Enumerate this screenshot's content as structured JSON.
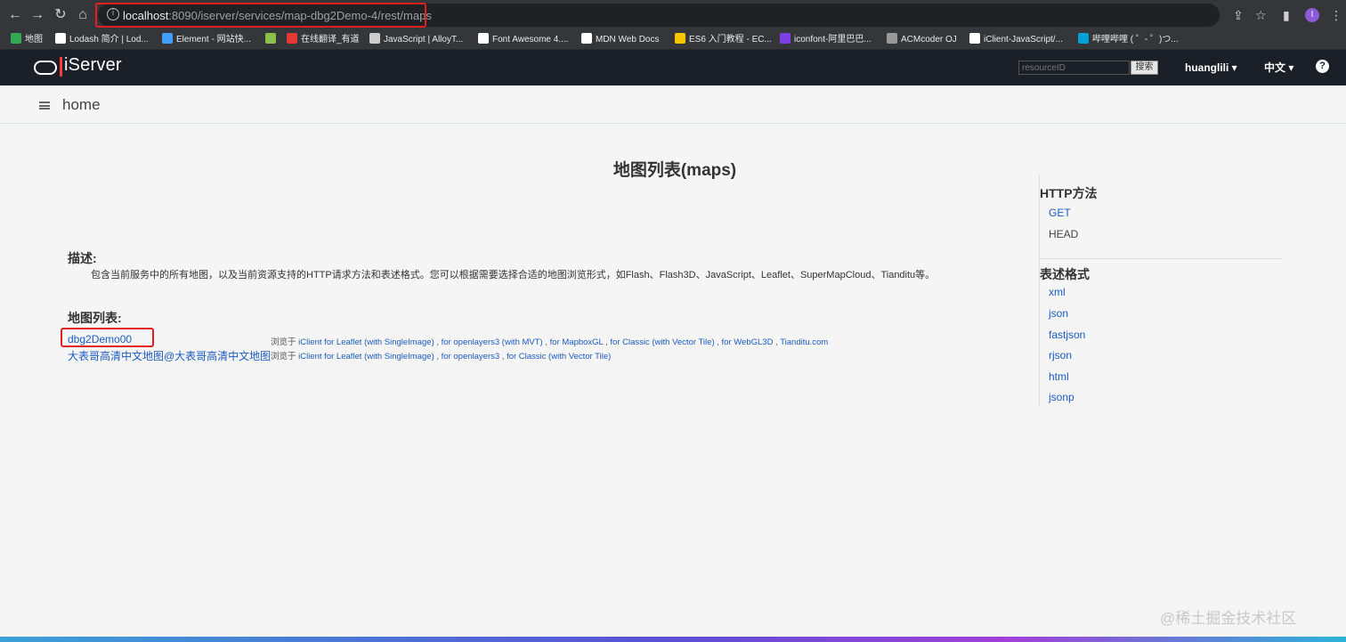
{
  "browser": {
    "url_host": "localhost",
    "url_rest": ":8090/iserver/services/map-dbg2Demo-4/rest/maps",
    "bookmarks": [
      {
        "label": "地图",
        "color": "#34a853"
      },
      {
        "label": "Lodash 简介 | Lod...",
        "color": "#ffffff"
      },
      {
        "label": "Element - 网站快...",
        "color": "#409eff"
      },
      {
        "label": "",
        "color": "#8bc34a"
      },
      {
        "label": "在线翻译_有道",
        "color": "#e53935"
      },
      {
        "label": "JavaScript | AlloyT...",
        "color": "#cccccc"
      },
      {
        "label": "Font Awesome 4....",
        "color": "#ffffff"
      },
      {
        "label": "MDN Web Docs",
        "color": "#ffffff"
      },
      {
        "label": "ES6 入门教程 - EC...",
        "color": "#f7c600"
      },
      {
        "label": "iconfont-阿里巴巴...",
        "color": "#7b3fe4"
      },
      {
        "label": "ACMcoder OJ",
        "color": "#999999"
      },
      {
        "label": "iClient-JavaScript/...",
        "color": "#ffffff"
      },
      {
        "label": "哔哩哔哩 ( ゜- ゜)つ...",
        "color": "#00a1d6"
      }
    ]
  },
  "header": {
    "logo_text": "iServer",
    "search_placeholder": "resourceID",
    "search_button": "搜索",
    "user": "huanglili ▾",
    "language": "中文 ▾",
    "help": "?"
  },
  "homebar": {
    "label": "home"
  },
  "main": {
    "title": "地图列表(maps)",
    "desc_label": "描述:",
    "desc_text": "包含当前服务中的所有地图，以及当前资源支持的HTTP请求方法和表述格式。您可以根据需要选择合适的地图浏览形式，如Flash、Flash3D、JavaScript、Leaflet、SuperMapCloud、Tianditu等。",
    "list_label": "地图列表:",
    "maps": [
      {
        "name": "dbg2Demo00",
        "browse_prefix": "浏览于 ",
        "links": [
          "iClient for Leaflet (with SingleImage)",
          "for openlayers3 (with MVT)",
          "for MapboxGL",
          "for Classic (with Vector Tile)",
          "for WebGL3D",
          "Tianditu.com"
        ]
      },
      {
        "name": "大表哥高清中文地图@大表哥高清中文地图",
        "browse_prefix": "浏览于 ",
        "links": [
          "iClient for Leaflet (with SingleImage)",
          "for openlayers3",
          "for Classic (with Vector Tile)"
        ]
      }
    ]
  },
  "sidebar": {
    "http_title": "HTTP方法",
    "http_methods": [
      "GET",
      "HEAD"
    ],
    "format_title": "表述格式",
    "formats": [
      "xml",
      "json",
      "fastjson",
      "rjson",
      "html",
      "jsonp"
    ]
  },
  "watermark": "@稀土掘金技术社区"
}
